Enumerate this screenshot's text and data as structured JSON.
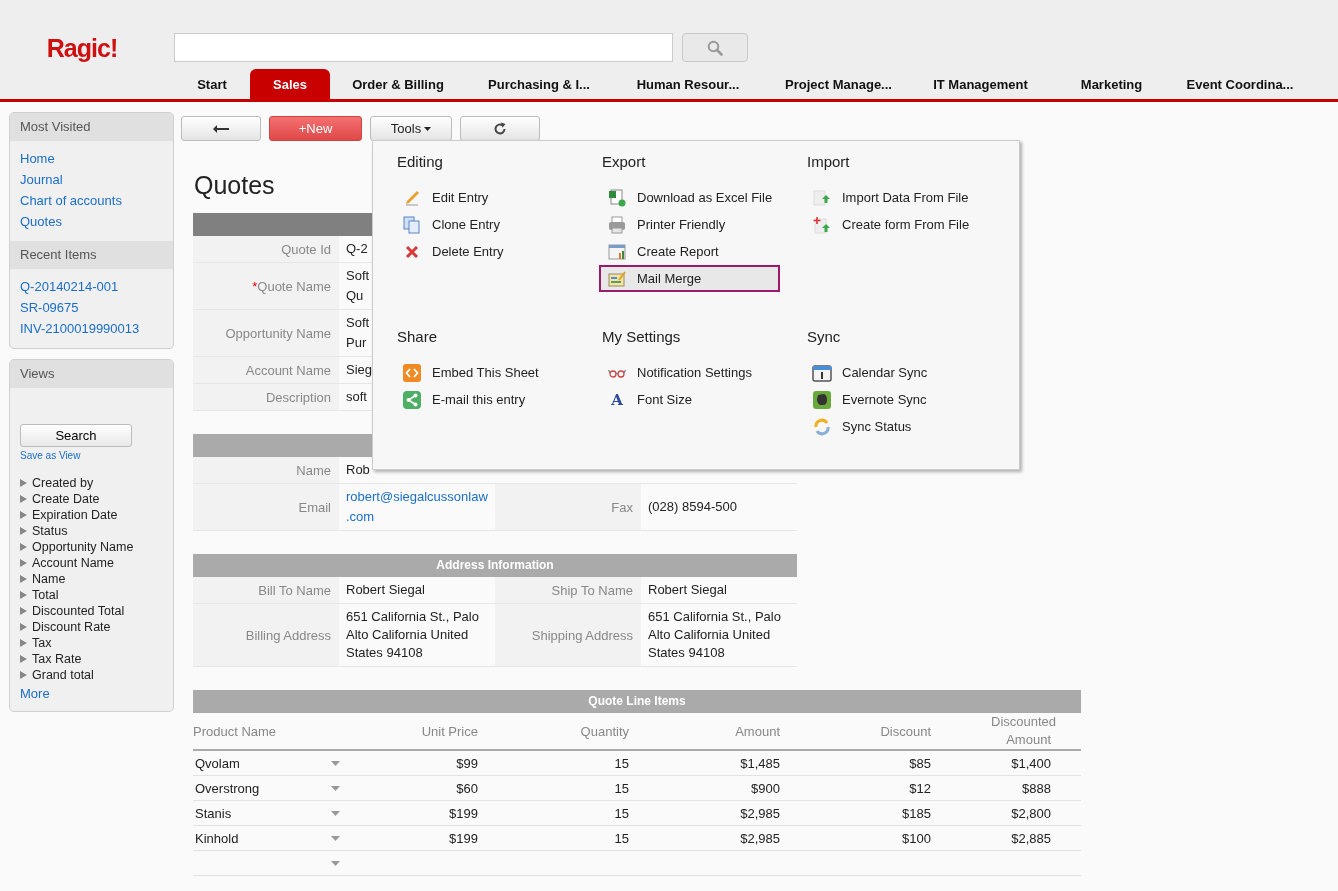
{
  "header": {
    "logo": "Ragic!"
  },
  "tabs": [
    {
      "label": "Start",
      "selected": false
    },
    {
      "label": "Sales",
      "selected": true
    },
    {
      "label": "Order & Billing",
      "selected": false
    },
    {
      "label": "Purchasing & I...",
      "selected": false
    },
    {
      "label": "Human Resour...",
      "selected": false
    },
    {
      "label": "Project Manage...",
      "selected": false
    },
    {
      "label": "IT Management",
      "selected": false
    },
    {
      "label": "Marketing",
      "selected": false
    },
    {
      "label": "Event Coordina...",
      "selected": false
    }
  ],
  "sidebar": {
    "panels": [
      {
        "title": "Most Visited",
        "groups": [
          {
            "links": [
              "Home",
              "Journal",
              "Chart of accounts",
              "Quotes"
            ]
          },
          {
            "title": "Recent Items",
            "links": [
              "Q-20140214-001",
              "SR-09675",
              "INV-2100019990013"
            ]
          }
        ]
      }
    ],
    "views": {
      "title": "Views",
      "search_button": "Search",
      "save_as_view": "Save as View",
      "fields": [
        "Created by",
        "Create Date",
        "Expiration Date",
        "Status",
        "Opportunity Name",
        "Account Name",
        "Name",
        "Total",
        "Discounted Total",
        "Discount Rate",
        "Tax",
        "Tax Rate",
        "Grand total"
      ],
      "more": "More"
    }
  },
  "toolbar": [
    {
      "kind": "back"
    },
    {
      "kind": "new",
      "label": "+New"
    },
    {
      "kind": "tools",
      "label": "Tools"
    },
    {
      "kind": "refresh"
    }
  ],
  "page_title": "Quotes",
  "sections": [
    {
      "kind": "primary",
      "rows": [
        {
          "cells": [
            {
              "label": "Quote Id",
              "values": [
                "Q-2"
              ]
            }
          ]
        },
        {
          "cells": [
            {
              "label": "Quote Name",
              "required_mark": "*",
              "values": [
                "Soft",
                "Qu"
              ]
            }
          ]
        },
        {
          "cells": [
            {
              "label": "Opportunity Name",
              "values": [
                "Soft",
                "Pur"
              ]
            }
          ]
        },
        {
          "cells": [
            {
              "label": "Account Name",
              "values": [
                "Sieg"
              ]
            }
          ]
        },
        {
          "cells": [
            {
              "label": "Description",
              "values": [
                "soft"
              ]
            }
          ]
        }
      ]
    },
    {
      "kind": "secondary",
      "rows": [
        {
          "cells": [
            {
              "label": "Name",
              "values": [
                "Rob"
              ]
            }
          ]
        },
        {
          "cells": [
            {
              "label": "Email",
              "values": [
                "robert@siegalcussonlaw",
                ".com"
              ],
              "link": true
            },
            {
              "label": "Fax",
              "values": [
                "(028) 8594-500"
              ]
            }
          ]
        }
      ]
    },
    {
      "kind": "secondary",
      "title": "Address Information",
      "rows": [
        {
          "cells": [
            {
              "label": "Bill To Name",
              "values": [
                "Robert Siegal"
              ]
            },
            {
              "label": "Ship To Name",
              "values": [
                "Robert Siegal"
              ]
            }
          ]
        },
        {
          "cells": [
            {
              "label": "Billing Address",
              "values": [
                "651 California St., Palo Alto California United States 94108"
              ]
            },
            {
              "label": "Shipping Address",
              "values": [
                "651 California St., Palo Alto California  United States 94108"
              ]
            }
          ]
        }
      ]
    }
  ],
  "line_items": {
    "title": "Quote Line Items",
    "columns": [
      "Product Name",
      "Unit Price",
      "Quantity",
      "Amount",
      "Discount",
      "Discounted Amount"
    ],
    "rows": [
      [
        "Qvolam",
        "$99",
        "15",
        "$1,485",
        "$85",
        "$1,400"
      ],
      [
        "Overstrong",
        "$60",
        "15",
        "$900",
        "$12",
        "$888"
      ],
      [
        "Stanis",
        "$199",
        "15",
        "$2,985",
        "$185",
        "$2,800"
      ],
      [
        "Kinhold",
        "$199",
        "15",
        "$2,985",
        "$100",
        "$2,885"
      ]
    ]
  },
  "tools_menu": {
    "sections": [
      {
        "title": "Editing",
        "items": [
          {
            "label": "Edit Entry",
            "selected": false
          },
          {
            "label": "Clone Entry",
            "selected": false
          },
          {
            "label": "Delete Entry",
            "selected": false
          }
        ]
      },
      {
        "title": "Export",
        "items": [
          {
            "label": "Download as Excel File",
            "selected": false
          },
          {
            "label": "Printer Friendly",
            "selected": false
          },
          {
            "label": "Create Report",
            "selected": false
          },
          {
            "label": "Mail Merge",
            "selected": true
          }
        ]
      },
      {
        "title": "Import",
        "items": [
          {
            "label": "Import Data From File",
            "selected": false
          },
          {
            "label": "Create form From File",
            "selected": false
          }
        ]
      },
      {
        "title": "Share",
        "items": [
          {
            "label": "Embed This Sheet",
            "selected": false
          },
          {
            "label": "E-mail this entry",
            "selected": false
          }
        ]
      },
      {
        "title": "My Settings",
        "items": [
          {
            "label": "Notification Settings",
            "selected": false
          },
          {
            "label": "Font Size",
            "selected": false,
            "glyph": "A"
          }
        ]
      },
      {
        "title": "Sync",
        "items": [
          {
            "label": "Calendar Sync",
            "selected": false
          },
          {
            "label": "Evernote Sync",
            "selected": false
          },
          {
            "label": "Sync Status",
            "selected": false
          }
        ]
      }
    ]
  }
}
